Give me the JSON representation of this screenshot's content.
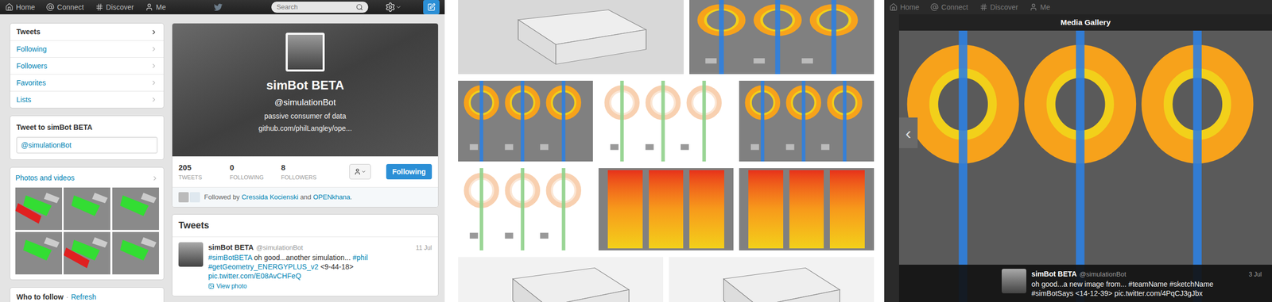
{
  "profile_page": {
    "nav": [
      {
        "label": "Home"
      },
      {
        "label": "Connect"
      },
      {
        "label": "Discover"
      },
      {
        "label": "Me"
      }
    ],
    "search": {
      "placeholder": "Search"
    },
    "sidebar": {
      "items": [
        {
          "label": "Tweets",
          "selected": true
        },
        {
          "label": "Following",
          "selected": false
        },
        {
          "label": "Followers",
          "selected": false
        },
        {
          "label": "Favorites",
          "selected": false
        },
        {
          "label": "Lists",
          "selected": false
        }
      ]
    },
    "tweet_to": {
      "title": "Tweet to simBot BETA",
      "value": "@simulationBot"
    },
    "photos": {
      "title": "Photos and videos",
      "thumbs": [
        {
          "kind": "red-green"
        },
        {
          "kind": "green"
        },
        {
          "kind": "green"
        },
        {
          "kind": "green"
        },
        {
          "kind": "red-green"
        },
        {
          "kind": "green"
        }
      ]
    },
    "who_to_follow": {
      "title": "Who to follow",
      "separator": "·",
      "refresh": "Refresh"
    },
    "profile": {
      "name": "simBot BETA",
      "handle": "@simulationBot",
      "bio": "passive consumer of data",
      "url": "github.com/philLangley/ope...",
      "stats": [
        {
          "value": "205",
          "label": "TWEETS"
        },
        {
          "value": "0",
          "label": "FOLLOWING"
        },
        {
          "value": "8",
          "label": "FOLLOWERS"
        }
      ],
      "follow_button": "Following",
      "followed_by": [
        {
          "text": "Followed by ",
          "link": false
        },
        {
          "text": "Cressida Kocienski",
          "link": true
        },
        {
          "text": " and ",
          "link": false
        },
        {
          "text": "OPENkhana",
          "link": true
        },
        {
          "text": ".",
          "link": false
        }
      ]
    },
    "tweets": {
      "title": "Tweets",
      "items": [
        {
          "name": "simBot BETA",
          "handle": "@simulationBot",
          "date": "11 Jul",
          "text": [
            {
              "text": "#simBotBETA",
              "link": true
            },
            {
              "text": " oh good...another simulation... ",
              "link": false
            },
            {
              "text": "#phil",
              "link": true
            },
            {
              "text": " ",
              "link": false
            },
            {
              "text": "#getGeometry_ENERGYPLUS_v2",
              "link": true
            },
            {
              "text": " <9-44-18> ",
              "link": false
            },
            {
              "text": "pic.twitter.com/E08AvCHFeQ",
              "link": true
            }
          ],
          "view_photo": "View photo"
        }
      ]
    }
  },
  "gallery": {
    "rows": [
      [
        {
          "kind": "building"
        },
        {
          "kind": "rings-dark"
        }
      ],
      [
        {
          "kind": "rings-dark"
        },
        {
          "kind": "rings-light"
        },
        {
          "kind": "rings-dark"
        }
      ],
      [
        {
          "kind": "rings-light"
        },
        {
          "kind": "bars"
        },
        {
          "kind": "bars"
        }
      ],
      [
        {
          "kind": "building-light"
        },
        {
          "kind": "building-light"
        }
      ]
    ]
  },
  "media_gallery": {
    "nav": [
      {
        "label": "Home"
      },
      {
        "label": "Connect"
      },
      {
        "label": "Discover"
      },
      {
        "label": "Me"
      }
    ],
    "title": "Media Gallery",
    "prev": "‹",
    "caption": {
      "name": "simBot BETA",
      "handle": "@simulationBot",
      "date": "3 Jul",
      "text": "oh good...a new image from... #teamName #sketchName #simBotSays <14-12-39> pic.twitter.com/4PqCJ3gJbx"
    }
  }
}
